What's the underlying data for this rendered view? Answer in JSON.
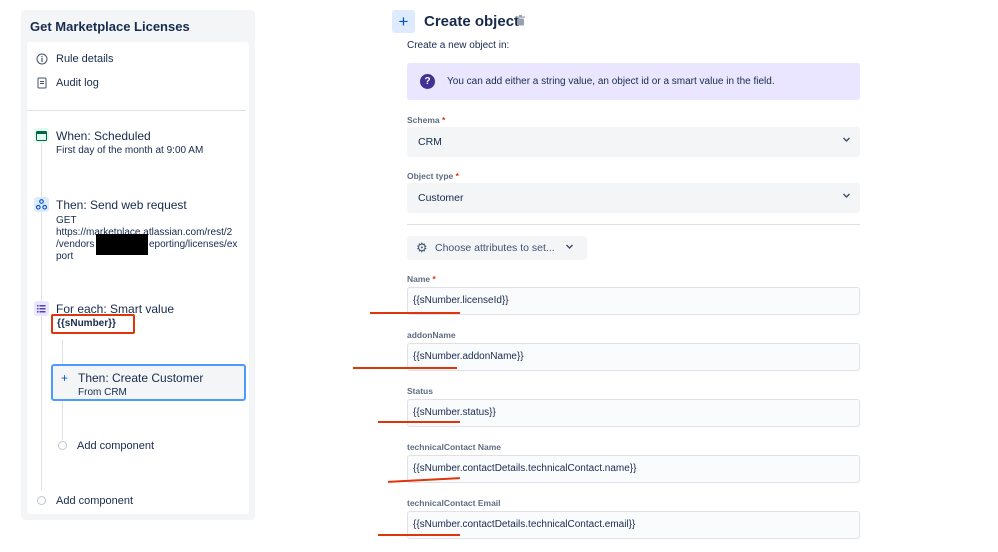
{
  "left": {
    "rule_title": "Get Marketplace Licenses",
    "nav": [
      {
        "label": "Rule details",
        "icon": "info-icon"
      },
      {
        "label": "Audit log",
        "icon": "document-icon"
      }
    ],
    "steps": {
      "trigger_title": "When: Scheduled",
      "trigger_sub": "First day of the month at 9:00 AM",
      "webreq_title": "Then: Send web request",
      "webreq_method": "GET",
      "webreq_url_1": "https://marketplace.atlassian.com/rest/2",
      "webreq_url_2": "/vendors",
      "webreq_url_2b": "eporting/licenses/ex",
      "webreq_url_3": "port",
      "foreach_title": "For each: Smart value",
      "foreach_value": "{{sNumber}}",
      "create_title": "Then: Create Customer",
      "create_sub": "From CRM",
      "add_component_nested": "Add component",
      "add_component": "Add component"
    }
  },
  "right": {
    "title": "Create object",
    "subtitle": "Create a new object in:",
    "info": "You can add either a string value, an object id or a smart value in the field.",
    "schema": {
      "label": "Schema",
      "required": "*",
      "value": "CRM"
    },
    "object_type": {
      "label": "Object type",
      "required": "*",
      "value": "Customer"
    },
    "choose_attributes": "Choose attributes to set...",
    "fields": [
      {
        "label": "Name",
        "required": "*",
        "value": "{{sNumber.licenseId}}"
      },
      {
        "label": "addonName",
        "required": "",
        "value": "{{sNumber.addonName}}"
      },
      {
        "label": "Status",
        "required": "",
        "value": "{{sNumber.status}}"
      },
      {
        "label": "technicalContact Name",
        "required": "",
        "value": "{{sNumber.contactDetails.technicalContact.name}}"
      },
      {
        "label": "technicalContact Email",
        "required": "",
        "value": "{{sNumber.contactDetails.technicalContact.email}}"
      }
    ]
  },
  "colors": {
    "annotation_red": "#DE350B",
    "selected_blue": "#4C9AFF",
    "info_purple": "#EAE6FF"
  }
}
